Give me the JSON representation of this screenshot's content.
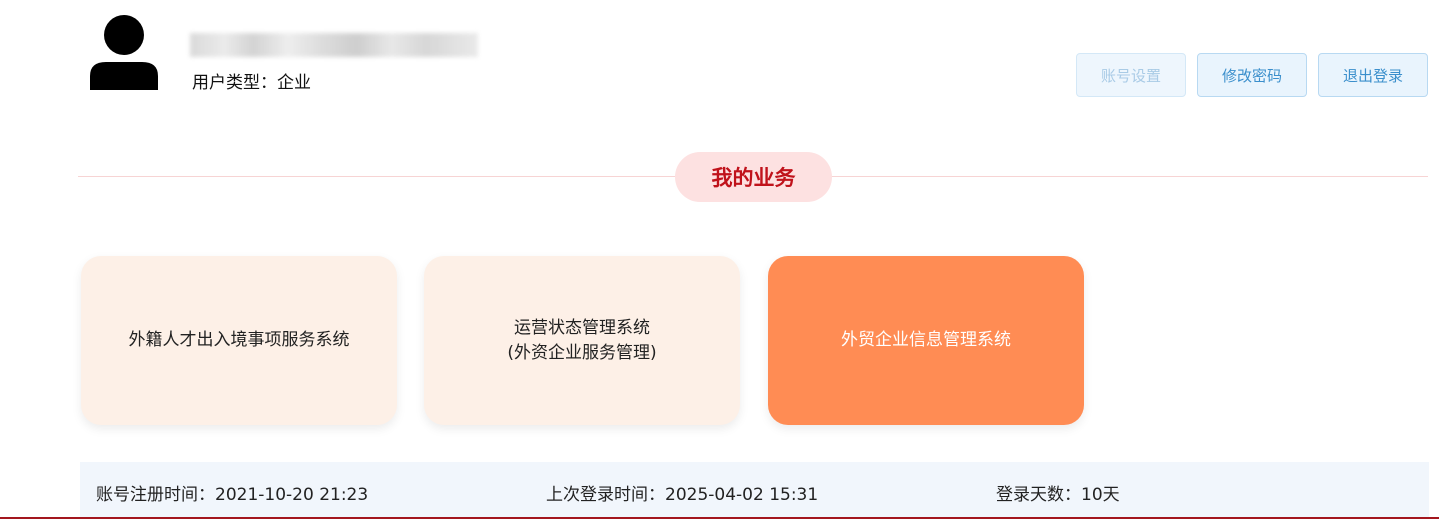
{
  "user": {
    "type_label": "用户类型：",
    "type_value": "企业"
  },
  "header_buttons": {
    "account_settings": "账号设置",
    "change_password": "修改密码",
    "logout": "退出登录"
  },
  "section": {
    "title": "我的业务"
  },
  "cards": [
    {
      "line1": "外籍人才出入境事项服务系统",
      "line2": ""
    },
    {
      "line1": "运营状态管理系统",
      "line2": "(外资企业服务管理)"
    },
    {
      "line1": "外贸企业信息管理系统",
      "line2": ""
    }
  ],
  "info": {
    "register_label": "账号注册时间：",
    "register_value": "2021-10-20 21:23",
    "last_login_label": "上次登录时间：",
    "last_login_value": "2025-04-02 15:31",
    "login_days_label": "登录天数：",
    "login_days_value": "10天"
  },
  "colors": {
    "accent_red": "#c0121b",
    "card_bg": "#fdf0e7",
    "card_active_bg": "#ff8c54",
    "button_bg": "#e9f4fd",
    "button_text": "#3b8fcc"
  },
  "icons": {
    "avatar": "user-silhouette-icon"
  }
}
